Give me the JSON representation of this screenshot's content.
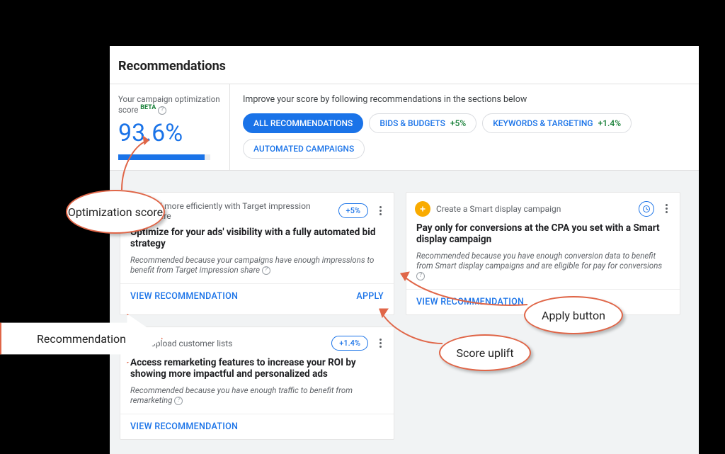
{
  "page_title": "Recommendations",
  "score": {
    "label": "Your campaign optimization score",
    "beta_tag": "BETA",
    "value": "93.6%",
    "fill_pct": 93.6
  },
  "improve": {
    "text": "Improve your score by following recommendations in the sections below",
    "chips": [
      {
        "label": "ALL RECOMMENDATIONS",
        "uplift": "",
        "active": true
      },
      {
        "label": "BIDS & BUDGETS",
        "uplift": "+5%",
        "active": false
      },
      {
        "label": "KEYWORDS & TARGETING",
        "uplift": "+1.4%",
        "active": false
      },
      {
        "label": "AUTOMATED CAMPAIGNS",
        "uplift": "",
        "active": false
      }
    ]
  },
  "cards": [
    {
      "icon": "trend-icon",
      "icon_class": "icon-blue",
      "subtitle": "Bid more efficiently with Target impression share",
      "uplift": "+5%",
      "title": "Optimize for your ads' visibility with a fully automated bid strategy",
      "reason": "Recommended because your campaigns have enough impressions to benefit from Target impression share",
      "view_label": "VIEW RECOMMENDATION",
      "apply_label": "APPLY"
    },
    {
      "icon": "plus-icon",
      "icon_class": "icon-orange",
      "subtitle": "Create a Smart display campaign",
      "uplift": "",
      "title": "Pay only for conversions at the CPA you set with a Smart display campaign",
      "reason": "Recommended because you have enough conversion data to benefit from Smart display campaigns and are eligible for pay for conversions",
      "view_label": "VIEW RECOMMENDATION",
      "apply_label": ""
    },
    {
      "icon": "person-icon",
      "icon_class": "icon-blue",
      "subtitle": "Upload customer lists",
      "uplift": "+1.4%",
      "title": "Access remarketing features to increase your ROI by showing more impactful and personalized ads",
      "reason": "Recommended because you have enough traffic to benefit from remarketing",
      "view_label": "VIEW RECOMMENDATION",
      "apply_label": ""
    }
  ],
  "callouts": {
    "opt_score": "Optimization score",
    "recommendation": "Recommendation",
    "apply": "Apply button",
    "uplift": "Score uplift"
  }
}
